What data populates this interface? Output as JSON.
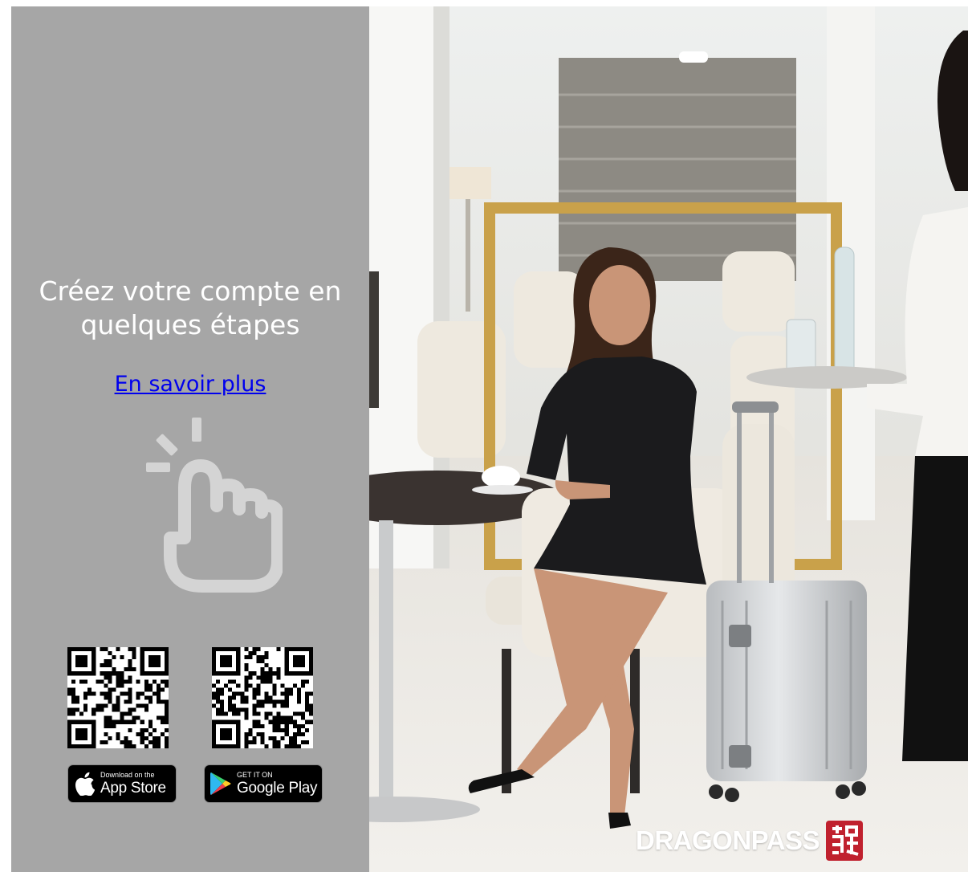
{
  "promo": {
    "headline": "Créez votre compte  en\nquelques étapes",
    "learn_more": "En savoir plus"
  },
  "badges": {
    "apple_small": "Download on the",
    "apple_big": "App Store",
    "google_small": "GET IT ON",
    "google_big": "Google Play"
  },
  "brand": {
    "name": "DRAGONPASS"
  },
  "icons": {
    "tap": "hand-tap-icon",
    "apple": "apple-logo-icon",
    "play": "google-play-icon"
  },
  "colors": {
    "panel": "#a6a6a6",
    "link": "#0000ee",
    "frame_gold": "#c9a14a",
    "seal_red": "#c0212e"
  }
}
